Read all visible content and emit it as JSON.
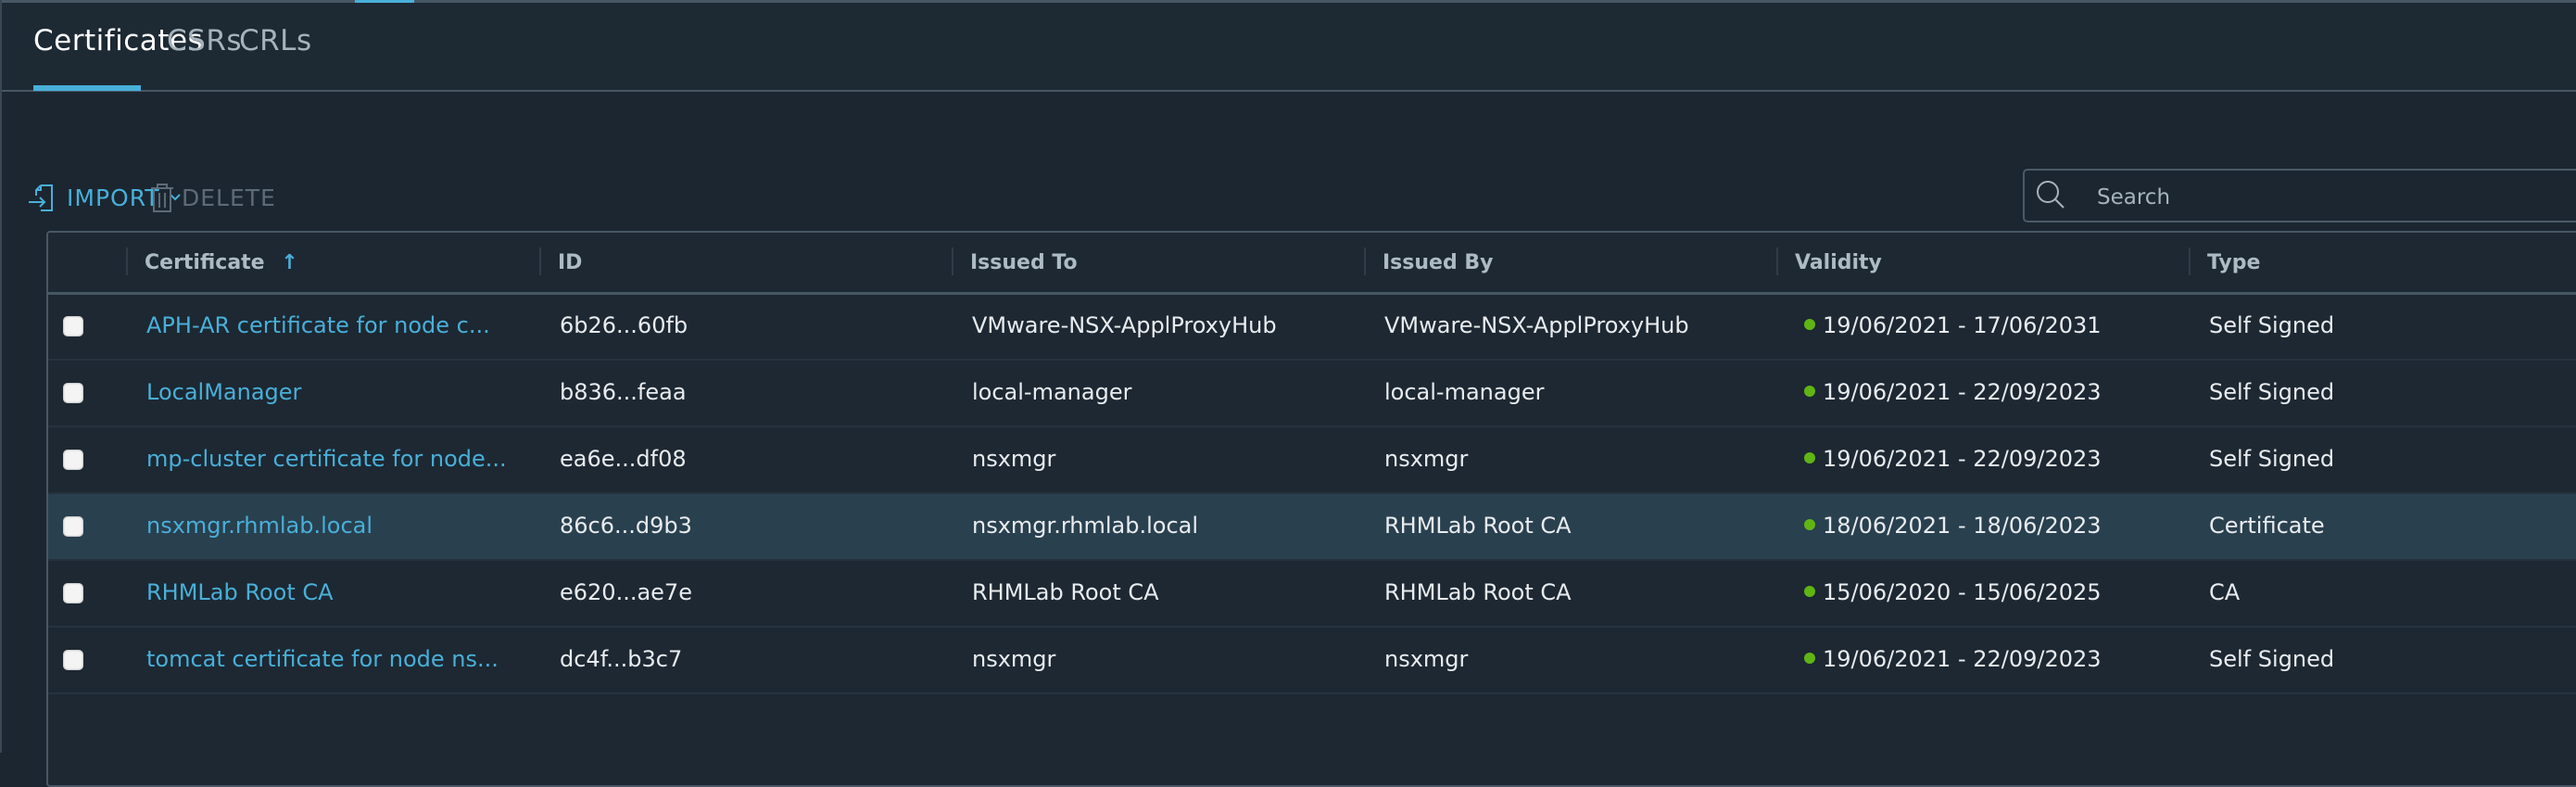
{
  "tabs": [
    {
      "label": "Certificates",
      "active": true
    },
    {
      "label": "CSRs",
      "active": false
    },
    {
      "label": "CRLs",
      "active": false
    }
  ],
  "toolbar": {
    "import_label": "IMPORT",
    "delete_label": "DELETE",
    "search_placeholder": "Search"
  },
  "colors": {
    "accent": "#49afd9",
    "valid": "#60b515",
    "selected_row": "#29404f"
  },
  "table": {
    "columns": [
      "Certificate",
      "ID",
      "Issued To",
      "Issued By",
      "Validity",
      "Type"
    ],
    "sort": {
      "column": "Certificate",
      "direction": "ascending"
    },
    "rows": [
      {
        "certificate": "APH-AR certificate for node c...",
        "id": "6b26...60fb",
        "issued_to": "VMware-NSX-ApplProxyHub",
        "issued_by": "VMware-NSX-ApplProxyHub",
        "validity": "19/06/2021 - 17/06/2031",
        "type": "Self Signed",
        "selected": false
      },
      {
        "certificate": "LocalManager",
        "id": "b836...feaa",
        "issued_to": "local-manager",
        "issued_by": "local-manager",
        "validity": "19/06/2021 - 22/09/2023",
        "type": "Self Signed",
        "selected": false
      },
      {
        "certificate": "mp-cluster certificate for node...",
        "id": "ea6e...df08",
        "issued_to": "nsxmgr",
        "issued_by": "nsxmgr",
        "validity": "19/06/2021 - 22/09/2023",
        "type": "Self Signed",
        "selected": false
      },
      {
        "certificate": "nsxmgr.rhmlab.local",
        "id": "86c6...d9b3",
        "issued_to": "nsxmgr.rhmlab.local",
        "issued_by": "RHMLab Root CA",
        "validity": "18/06/2021 - 18/06/2023",
        "type": "Certificate",
        "selected": true
      },
      {
        "certificate": "RHMLab Root CA",
        "id": "e620...ae7e",
        "issued_to": "RHMLab Root CA",
        "issued_by": "RHMLab Root CA",
        "validity": "15/06/2020 - 15/06/2025",
        "type": "CA",
        "selected": false
      },
      {
        "certificate": "tomcat certificate for node ns...",
        "id": "dc4f...b3c7",
        "issued_to": "nsxmgr",
        "issued_by": "nsxmgr",
        "validity": "19/06/2021 - 22/09/2023",
        "type": "Self Signed",
        "selected": false
      }
    ]
  }
}
